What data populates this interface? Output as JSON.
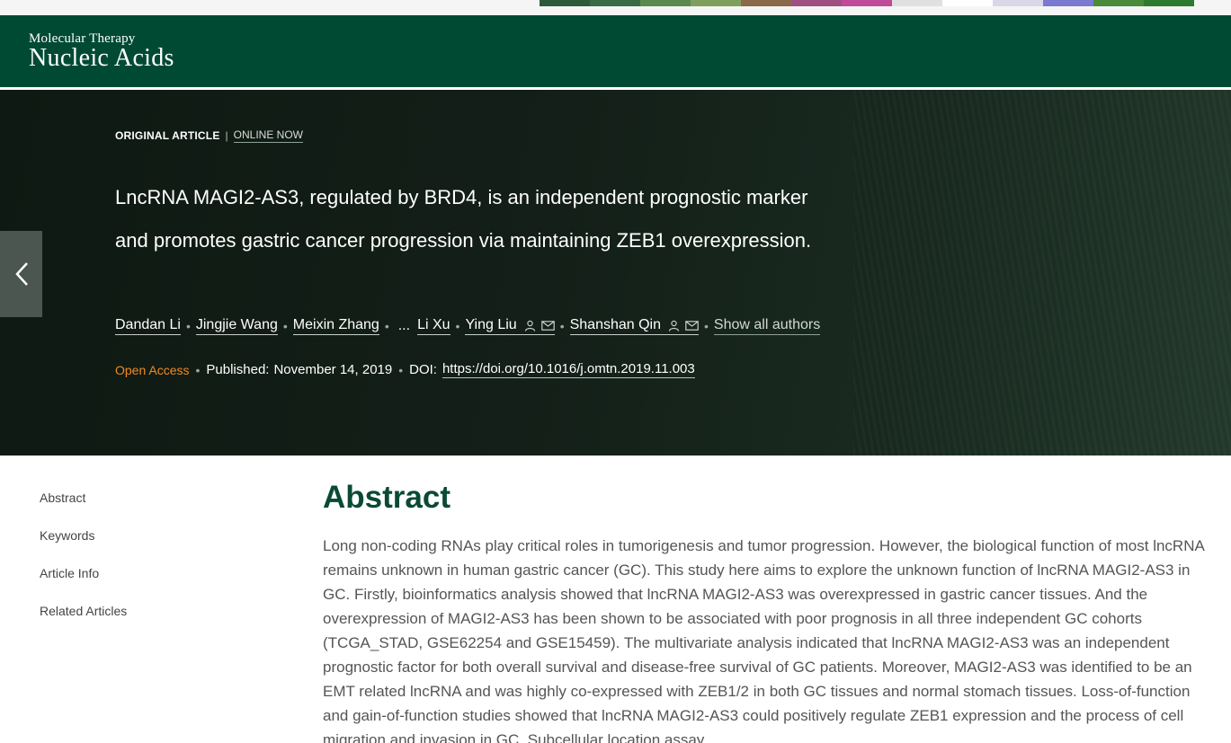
{
  "banner": {
    "colors": [
      "#2e5a3c",
      "#3a6b44",
      "#5a8a50",
      "#7fa05c",
      "#8a6a4a",
      "#a05080",
      "#c04a9a",
      "#e0e0e0",
      "#ffffff",
      "#d8d8e8",
      "#7a7ad0",
      "#4a8a3a",
      "#2e7a2e"
    ]
  },
  "journal": {
    "supertitle": "Molecular Therapy",
    "title": "Nucleic Acids"
  },
  "article": {
    "type": "ORIGINAL ARTICLE",
    "type_separator": "|",
    "status": "ONLINE NOW",
    "title": "LncRNA MAGI2-AS3, regulated by BRD4, is an independent prognostic marker and promotes gastric cancer progression via maintaining ZEB1 overexpression.",
    "authors": [
      "Dandan Li",
      "Jingjie Wang",
      "Meixin Zhang",
      "Li Xu",
      "Ying Liu",
      "Shanshan Qin"
    ],
    "ellipsis": "...",
    "show_all_authors": "Show all authors",
    "access": "Open Access",
    "published_label": "Published:",
    "published_date": "November 14, 2019",
    "doi_label": "DOI:",
    "doi_url": "https://doi.org/10.1016/j.omtn.2019.11.003"
  },
  "sidebar": {
    "items": [
      {
        "label": "Abstract"
      },
      {
        "label": "Keywords"
      },
      {
        "label": "Article Info"
      },
      {
        "label": "Related Articles"
      }
    ]
  },
  "abstract": {
    "heading": "Abstract",
    "text": "Long non-coding RNAs play critical roles in tumorigenesis and tumor progression. However, the biological function of most lncRNA remains unknown in human gastric cancer (GC). This study here aims to explore the unknown function of lncRNA MAGI2-AS3 in GC. Firstly, bioinformatics analysis showed that lncRNA MAGI2-AS3 was overexpressed in gastric cancer tissues. And the overexpression of MAGI2-AS3 has been shown to be associated with poor prognosis in all three independent GC cohorts (TCGA_STAD, GSE62254 and GSE15459). The multivariate analysis indicated that lncRNA MAGI2-AS3 was an independent prognostic factor for both overall survival and disease-free survival of GC patients. Moreover, MAGI2-AS3 was identified to be an EMT related lncRNA and was highly co-expressed with ZEB1/2 in both GC tissues and normal stomach tissues. Loss-of-function and gain-of-function studies showed that lncRNA MAGI2-AS3 could positively regulate ZEB1 expression and the process of cell migration and invasion in GC. Subcellular location assay"
  },
  "icons": {
    "prev": "chevron-left-icon",
    "person": "person-icon",
    "mail": "mail-icon"
  }
}
